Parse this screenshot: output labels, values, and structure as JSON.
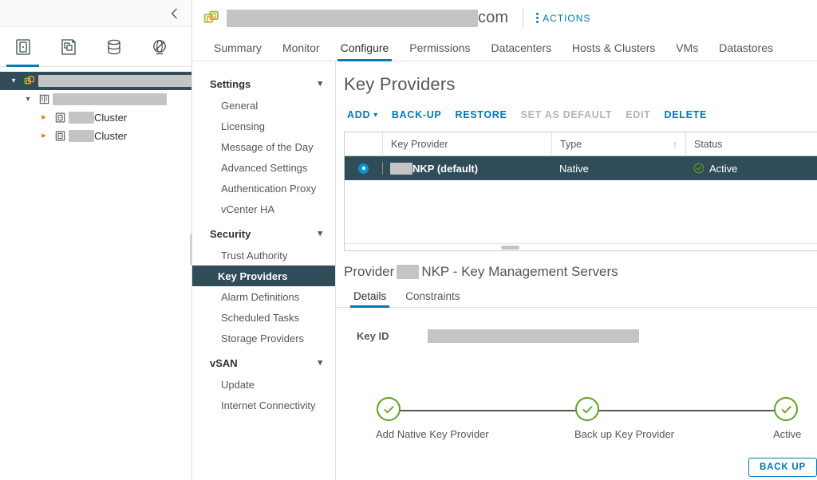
{
  "left_panel": {
    "collapse_icon": "chevron-left-icon",
    "inventory_tabs": [
      {
        "name": "hosts-and-clusters",
        "icon": "host-cluster-icon",
        "active": true
      },
      {
        "name": "vms-and-templates",
        "icon": "vm-icon",
        "active": false
      },
      {
        "name": "storage",
        "icon": "storage-icon",
        "active": false
      },
      {
        "name": "networking",
        "icon": "network-icon",
        "active": false
      }
    ],
    "tree": [
      {
        "indent": 0,
        "twisty": "down",
        "icon": "vcenter-icon",
        "redacted_width": 196,
        "label": "",
        "selected": true
      },
      {
        "indent": 1,
        "twisty": "down",
        "icon": "datacenter-icon",
        "redacted_width": 143,
        "label": "",
        "selected": false
      },
      {
        "indent": 2,
        "twisty": "right",
        "icon": "cluster-icon",
        "redacted_width": 32,
        "label": "Cluster",
        "selected": false
      },
      {
        "indent": 2,
        "twisty": "right",
        "icon": "cluster-icon",
        "redacted_width": 32,
        "label": "Cluster",
        "selected": false
      }
    ]
  },
  "header": {
    "object_icon": "vcenter-icon",
    "title_redacted_width": 315,
    "title_suffix": "com",
    "actions_label": "ACTIONS",
    "actions_icon": "kebab-menu-icon"
  },
  "tabs": [
    {
      "label": "Summary",
      "active": false
    },
    {
      "label": "Monitor",
      "active": false
    },
    {
      "label": "Configure",
      "active": true
    },
    {
      "label": "Permissions",
      "active": false
    },
    {
      "label": "Datacenters",
      "active": false
    },
    {
      "label": "Hosts & Clusters",
      "active": false
    },
    {
      "label": "VMs",
      "active": false
    },
    {
      "label": "Datastores",
      "active": false
    }
  ],
  "settings_nav": [
    {
      "type": "group",
      "label": "Settings",
      "expanded": true
    },
    {
      "type": "item",
      "label": "General",
      "active": false
    },
    {
      "type": "item",
      "label": "Licensing",
      "active": false
    },
    {
      "type": "item",
      "label": "Message of the Day",
      "active": false
    },
    {
      "type": "item",
      "label": "Advanced Settings",
      "active": false
    },
    {
      "type": "item",
      "label": "Authentication Proxy",
      "active": false
    },
    {
      "type": "item",
      "label": "vCenter HA",
      "active": false
    },
    {
      "type": "group",
      "label": "Security",
      "expanded": true
    },
    {
      "type": "item",
      "label": "Trust Authority",
      "active": false
    },
    {
      "type": "item",
      "label": "Key Providers",
      "active": true
    },
    {
      "type": "item",
      "label": "Alarm Definitions",
      "active": false
    },
    {
      "type": "item",
      "label": "Scheduled Tasks",
      "active": false
    },
    {
      "type": "item",
      "label": "Storage Providers",
      "active": false
    },
    {
      "type": "group",
      "label": "vSAN",
      "expanded": true
    },
    {
      "type": "item",
      "label": "Update",
      "active": false
    },
    {
      "type": "item",
      "label": "Internet Connectivity",
      "active": false
    }
  ],
  "main": {
    "page_title": "Key Providers",
    "toolbar": [
      {
        "label": "ADD",
        "has_caret": true,
        "disabled": false
      },
      {
        "label": "BACK-UP",
        "has_caret": false,
        "disabled": false
      },
      {
        "label": "RESTORE",
        "has_caret": false,
        "disabled": false
      },
      {
        "label": "SET AS DEFAULT",
        "has_caret": false,
        "disabled": true
      },
      {
        "label": "EDIT",
        "has_caret": false,
        "disabled": true
      },
      {
        "label": "DELETE",
        "has_caret": false,
        "disabled": false
      }
    ],
    "table": {
      "columns": [
        {
          "label": "",
          "key": "select"
        },
        {
          "label": "Key Provider",
          "key": "provider"
        },
        {
          "label": "Type",
          "key": "type",
          "sort": "asc",
          "sort_icon": "arrow-up-icon"
        },
        {
          "label": "Status",
          "key": "status"
        }
      ],
      "rows": [
        {
          "selected": true,
          "provider_redacted_width": 28,
          "provider": "NKP (default)",
          "type": "Native",
          "status": "Active",
          "status_icon": "check-circle-icon"
        }
      ]
    },
    "provider_section": {
      "title_prefix": "Provider",
      "title_redacted_width": 28,
      "title_suffix": "NKP - Key Management Servers",
      "subtabs": [
        {
          "label": "Details",
          "active": true
        },
        {
          "label": "Constraints",
          "active": false
        }
      ],
      "key_id_label": "Key ID",
      "key_id_redacted_width": 265,
      "stepper": [
        {
          "label": "Add Native Key Provider",
          "state": "complete",
          "icon": "check-circle-icon"
        },
        {
          "label": "Back up Key Provider",
          "state": "complete",
          "icon": "check-circle-icon"
        },
        {
          "label": "Active",
          "state": "complete",
          "icon": "check-circle-icon"
        }
      ],
      "backup_button": "BACK UP"
    }
  },
  "colors": {
    "accent_blue": "#0079b8",
    "selection_navy": "#2F4C58",
    "status_green": "#62A420",
    "radio_blue": "#0095d3",
    "redaction_gray": "#c4c4c4"
  }
}
